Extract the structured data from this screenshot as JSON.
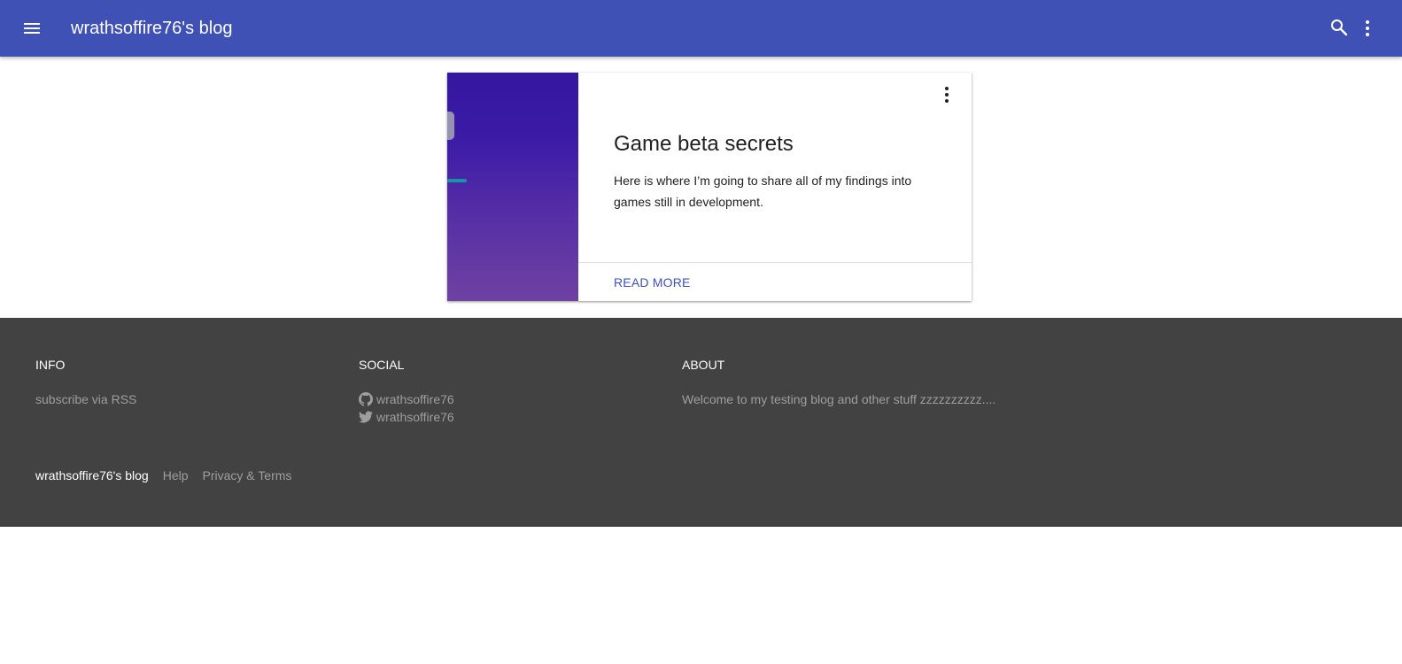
{
  "appbar": {
    "title": "wrathsoffire76's blog",
    "menu_icon": "menu-icon",
    "search_icon": "search-icon",
    "more_icon": "more-vert-icon",
    "background": "#3f51b5"
  },
  "post": {
    "title": "Game beta secrets",
    "excerpt": "Here is where I’m going to share all of my findings into games still in development.",
    "action_label": "READ MORE",
    "menu_icon": "more-vert-icon",
    "accent": "#3f51b5"
  },
  "footer": {
    "info": {
      "heading": "INFO",
      "links": [
        "subscribe via RSS"
      ]
    },
    "social": {
      "heading": "SOCIAL",
      "items": [
        {
          "icon": "github-icon",
          "label": "wrathsoffire76"
        },
        {
          "icon": "twitter-icon",
          "label": "wrathsoffire76"
        }
      ]
    },
    "about": {
      "heading": "ABOUT",
      "text": "Welcome to my testing blog and other stuff zzzzzzzzzz...."
    },
    "bottom": {
      "brand": "wrathsoffire76's blog",
      "links": [
        "Help",
        "Privacy & Terms"
      ]
    },
    "background": "#424242"
  }
}
